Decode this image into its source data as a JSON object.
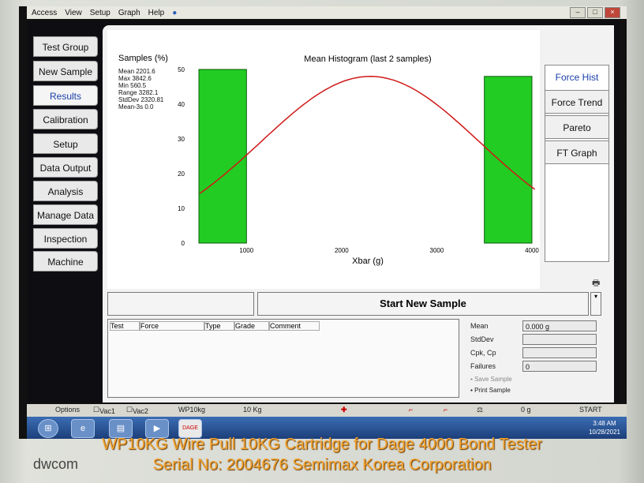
{
  "menu": [
    "Access",
    "View",
    "Setup",
    "Graph",
    "Help"
  ],
  "nav": [
    {
      "label": "Test Group"
    },
    {
      "label": "New Sample"
    },
    {
      "label": "Results",
      "active": true
    },
    {
      "label": "Calibration"
    },
    {
      "label": "Setup"
    },
    {
      "label": "Data Output"
    },
    {
      "label": "Analysis"
    },
    {
      "label": "Manage Data"
    },
    {
      "label": "Inspection"
    },
    {
      "label": "Machine"
    }
  ],
  "right_tabs": [
    {
      "label": "Force Hist",
      "active": true
    },
    {
      "label": "Force Trend"
    },
    {
      "label": "Pareto"
    },
    {
      "label": "FT Graph"
    }
  ],
  "stats": {
    "heading": "Samples (%)",
    "mean": "Mean 2201.6",
    "max": "Max 3842.6",
    "min": "Min 560.5",
    "range": "Range 3282.1",
    "stddev": "StdDev 2320.81",
    "mean3s": "Mean-3s 0.0"
  },
  "chart_data": {
    "type": "bar",
    "title": "Mean Histogram (last 2 samples)",
    "xlabel": "Xbar (g)",
    "ylabel": "",
    "x_ticks": [
      "1000",
      "2000",
      "3000",
      "4000"
    ],
    "y_ticks": [
      "0",
      "10",
      "20",
      "30",
      "40",
      "50"
    ],
    "xlim": [
      450,
      4050
    ],
    "ylim": [
      0,
      50
    ],
    "bars": [
      {
        "x0": 500,
        "x1": 1000,
        "value": 50
      },
      {
        "x0": 3500,
        "x1": 4000,
        "value": 48
      }
    ],
    "curve": {
      "name": "",
      "mean": 2300,
      "peak": 48,
      "sd": 1150
    }
  },
  "start_button": "Start New Sample",
  "table_headers": [
    "Test",
    "Force",
    "Type",
    "Grade",
    "Comment"
  ],
  "results": {
    "mean_label": "Mean",
    "mean_value": "0.000 g",
    "stddev_label": "StdDev",
    "cpk_label": "Cpk, Cp",
    "failures_label": "Failures",
    "failures_value": "0",
    "save_label": "Save Sample",
    "print_label": "Print Sample"
  },
  "status": {
    "options": "Options",
    "vac1": "Vac1",
    "vac2": "Vac2",
    "cartridge": "WP10kg",
    "load": "10 Kg",
    "force": "0 g",
    "start": "START"
  },
  "clock": {
    "time": "3:48 AM",
    "date": "10/28/2021"
  },
  "window_icons": [
    "print-icon"
  ],
  "caption1": "WP10KG Wire Pull 10KG Cartridge for Dage 4000 Bond Tester",
  "caption2": "Serial No: 2004676   Semimax Korea Corporation",
  "logo": "dwcom",
  "colors": {
    "bar": "#22cc22",
    "curve": "#d01818",
    "caption": "#f4a12a",
    "active_tab": "#1b3fa8"
  }
}
